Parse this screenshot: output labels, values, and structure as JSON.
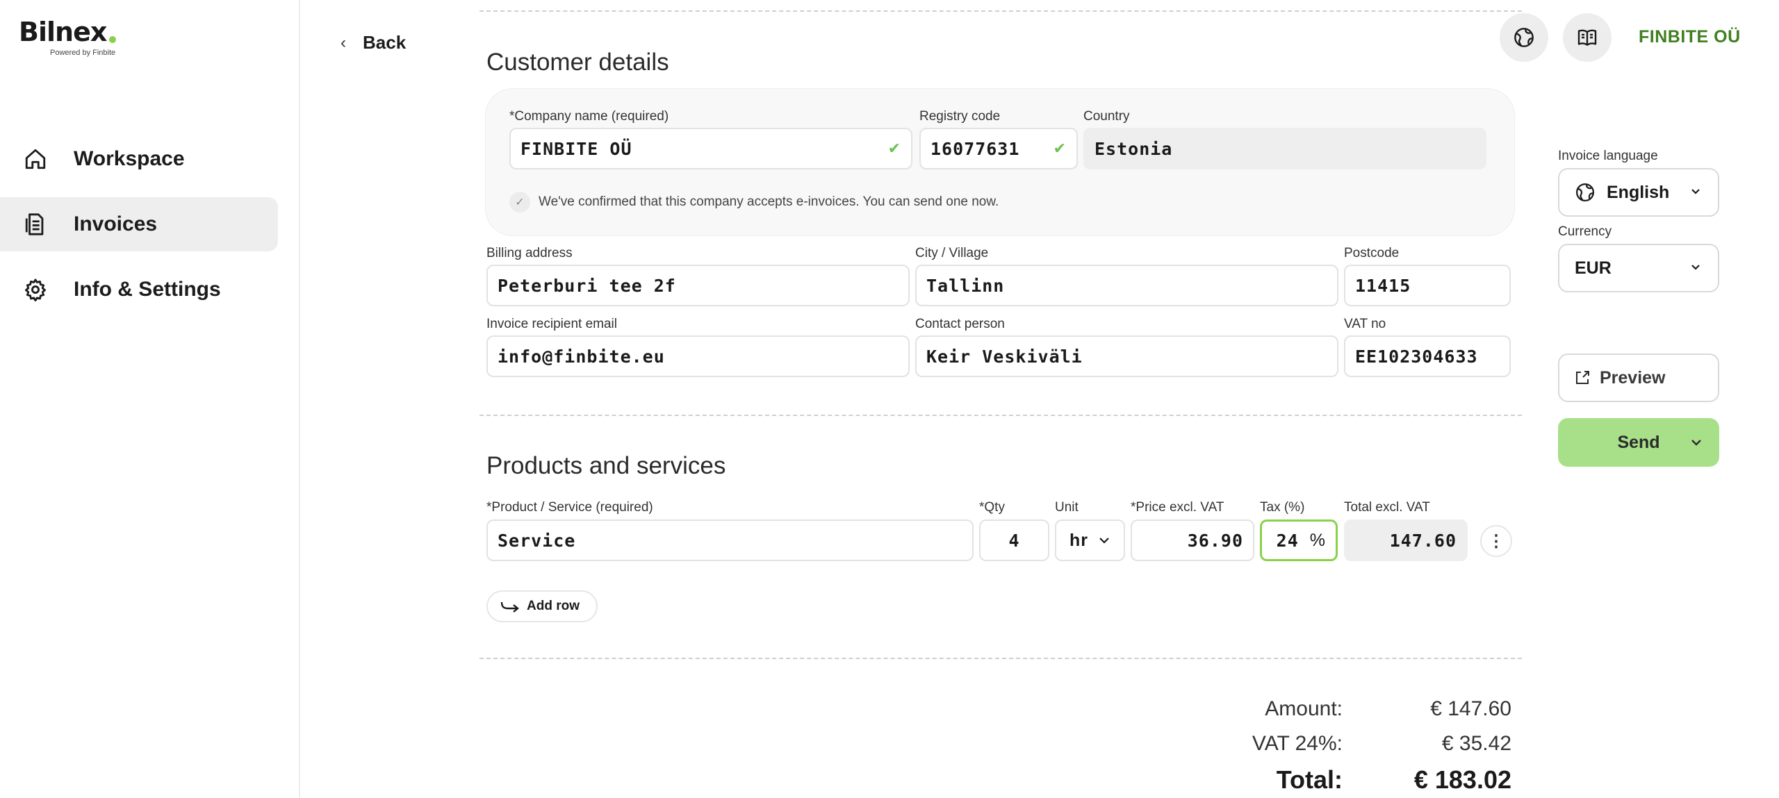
{
  "brand": {
    "logo_text": "Bilnex",
    "logo_sub": "Powered by Finbite",
    "accent": "#8ad14a"
  },
  "nav": {
    "back_label": "Back",
    "items": [
      {
        "label": "Workspace",
        "icon": "home-icon"
      },
      {
        "label": "Invoices",
        "icon": "document-icon",
        "active": true
      },
      {
        "label": "Info & Settings",
        "icon": "gear-icon"
      }
    ]
  },
  "header": {
    "company": "FINBITE OÜ",
    "company_color": "#3f7f1f"
  },
  "customer": {
    "title": "Customer details",
    "company_name_label": "*Company name (required)",
    "company_name": "FINBITE OÜ",
    "registry_code_label": "Registry code",
    "registry_code": "16077631",
    "country_label": "Country",
    "country": "Estonia",
    "confirm_text": "We've confirmed that this company accepts e-invoices. You can send one now.",
    "billing_address_label": "Billing address",
    "billing_address": "Peterburi tee 2f",
    "city_label": "City / Village",
    "city": "Tallinn",
    "postcode_label": "Postcode",
    "postcode": "11415",
    "email_label": "Invoice recipient email",
    "email": "info@finbite.eu",
    "contact_label": "Contact person",
    "contact": "Keir Veskiväli",
    "vat_no_label": "VAT no",
    "vat_no": "EE102304633"
  },
  "products": {
    "title": "Products and services",
    "product_label": "*Product / Service (required)",
    "qty_label": "*Qty",
    "unit_label": "Unit",
    "price_label": "*Price excl. VAT",
    "tax_label": "Tax (%)",
    "total_label": "Total excl. VAT",
    "rows": [
      {
        "product": "Service",
        "qty": "4",
        "unit": "hr",
        "price": "36.90",
        "tax": "24",
        "tax_suffix": "%",
        "total": "147.60"
      }
    ],
    "add_row_label": "Add row"
  },
  "summary": {
    "amount_label": "Amount:",
    "amount": "€ 147.60",
    "vat_label": "VAT 24%:",
    "vat": "€ 35.42",
    "total_label": "Total:",
    "total": "€ 183.02"
  },
  "sidepanel": {
    "language_label": "Invoice language",
    "language": "English",
    "currency_label": "Currency",
    "currency": "EUR",
    "preview_label": "Preview",
    "send_label": "Send",
    "send_color": "#a8e089"
  }
}
